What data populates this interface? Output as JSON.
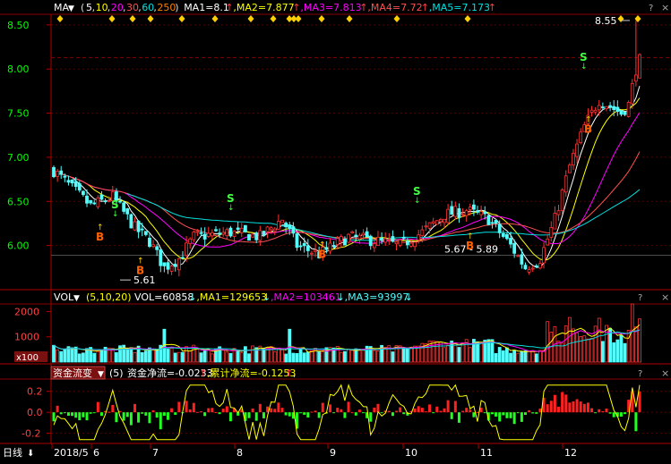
{
  "colors": {
    "background": "#000000",
    "up": "#ff3232",
    "down": "#54fcfc",
    "ma1": "#ffffff",
    "ma2": "#ffff00",
    "ma3": "#ff00ff",
    "ma4": "#ff5050",
    "ma5": "#00e0e0",
    "price_axis": "#00ff00",
    "net_flow_line": "#ffff00",
    "flow_up": "#ff2020",
    "flow_down": "#20ff20",
    "signal_s": "#40ff40",
    "signal_b": "#ff6000",
    "diamond": "#ffd000",
    "frame": "#b00000"
  },
  "price_panel": {
    "indicator": "MA",
    "params": [
      "5",
      "10",
      "20",
      "30",
      "60",
      "250"
    ],
    "ma_labels": [
      {
        "text": "MA1=8.1",
        "arrow": "↑",
        "color": "#ffffff"
      },
      {
        "text": "MA2=7.877",
        "arrow": "↑",
        "color": "#ffff00"
      },
      {
        "text": "MA3=7.813",
        "arrow": "↑",
        "color": "#ff00ff"
      },
      {
        "text": "MA4=7.72",
        "arrow": "↑",
        "color": "#ff5050"
      },
      {
        "text": "MA5=7.173",
        "arrow": "↑",
        "color": "#00e0e0"
      }
    ],
    "y_ticks": [
      "8.50",
      "8.00",
      "7.50",
      "7.00",
      "6.50",
      "6.00"
    ],
    "annotations": {
      "high": "8.55",
      "low": "5.61",
      "range": "5.67 - 5.89"
    },
    "signals": {
      "sell": "S",
      "buy": "B"
    }
  },
  "volume_panel": {
    "indicator": "VOL",
    "params": "(5,10,20)",
    "values": [
      {
        "text": "VOL=60858",
        "arrow": "↓",
        "color": "#ffffff"
      },
      {
        "text": "MA1=129653",
        "arrow": "↓",
        "color": "#ffff00"
      },
      {
        "text": "MA2=103461",
        "arrow": "↓",
        "color": "#ff00ff"
      },
      {
        "text": "MA3=93997",
        "arrow": "↓",
        "color": "#54fcfc"
      }
    ],
    "y_ticks": [
      "2000",
      "1000"
    ],
    "unit": "x100"
  },
  "flow_panel": {
    "indicator": "资金流变",
    "param": "(5)",
    "values": [
      {
        "text": "资金净流=-0.0233",
        "arrow": "↑",
        "color": "#ffffff"
      },
      {
        "text": "累计净流=-0.1253",
        "arrow": "↑",
        "color": "#ffff00"
      }
    ],
    "trailing": ",",
    "y_ticks": [
      "0.2",
      "0.0",
      "-0.2"
    ]
  },
  "x_axis": {
    "period": "日线",
    "labels": [
      "2018/5",
      "6",
      "7",
      "8",
      "9",
      "10",
      "11",
      "12"
    ]
  },
  "help_icon": "?",
  "close_icon": "×",
  "chart_data": {
    "type": "candlestick",
    "period": "日线",
    "y_range": [
      5.5,
      8.6
    ],
    "x_labels": [
      "2018/5",
      "6",
      "7",
      "8",
      "9",
      "10",
      "11",
      "12"
    ],
    "ohlc_anchors": [
      {
        "month": "2018/5",
        "close": 6.85
      },
      {
        "month": "6",
        "close": 5.85
      },
      {
        "month": "7",
        "close": 6.15
      },
      {
        "month": "8",
        "close": 6.1
      },
      {
        "month": "9",
        "close": 6.05
      },
      {
        "month": "10",
        "close": 6.35
      },
      {
        "month": "11",
        "close": 7.3
      },
      {
        "month": "12",
        "close": 7.85
      }
    ],
    "last_close": 8.1,
    "high": 8.55,
    "low": 5.61,
    "moving_averages": [
      {
        "name": "MA1",
        "value": 8.1
      },
      {
        "name": "MA2",
        "value": 7.877
      },
      {
        "name": "MA3",
        "value": 7.813
      },
      {
        "name": "MA4",
        "value": 7.72
      },
      {
        "name": "MA5",
        "value": 7.173
      }
    ],
    "volume": {
      "last": 60858,
      "ma": [
        129653,
        103461,
        93997
      ],
      "y_ticks": [
        1000,
        2000
      ],
      "unit": "x100"
    },
    "fund_flow": {
      "net": -0.0233,
      "cumulative": -0.1253,
      "y_ticks": [
        -0.2,
        0.0,
        0.2
      ]
    }
  }
}
